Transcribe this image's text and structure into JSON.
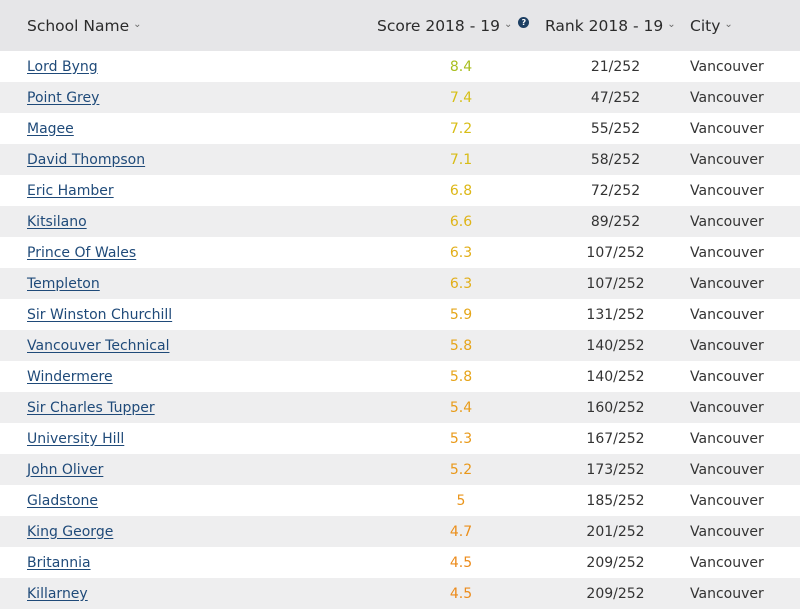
{
  "header": {
    "school_name": "School Name",
    "score": "Score 2018 - 19",
    "rank": "Rank 2018 - 19",
    "city": "City",
    "caret_icon": "chevron-down-icon",
    "help_icon": "?"
  },
  "colors": {
    "header_bg": "#e6e6e8",
    "link": "#1f4a79",
    "stripe": "#eeeeef"
  },
  "rows": [
    {
      "name": "Lord Byng",
      "score": "8.4",
      "rank": "21/252",
      "city": "Vancouver",
      "score_color": "#a8be1e"
    },
    {
      "name": "Point Grey",
      "score": "7.4",
      "rank": "47/252",
      "city": "Vancouver",
      "score_color": "#d6bf16"
    },
    {
      "name": "Magee",
      "score": "7.2",
      "rank": "55/252",
      "city": "Vancouver",
      "score_color": "#d8bd16"
    },
    {
      "name": "David Thompson",
      "score": "7.1",
      "rank": "58/252",
      "city": "Vancouver",
      "score_color": "#d8bc16"
    },
    {
      "name": "Eric Hamber",
      "score": "6.8",
      "rank": "72/252",
      "city": "Vancouver",
      "score_color": "#ddb716"
    },
    {
      "name": "Kitsilano",
      "score": "6.6",
      "rank": "89/252",
      "city": "Vancouver",
      "score_color": "#dfb417"
    },
    {
      "name": "Prince Of Wales",
      "score": "6.3",
      "rank": "107/252",
      "city": "Vancouver",
      "score_color": "#e2ae18"
    },
    {
      "name": "Templeton",
      "score": "6.3",
      "rank": "107/252",
      "city": "Vancouver",
      "score_color": "#e2ae18"
    },
    {
      "name": "Sir Winston Churchill",
      "score": "5.9",
      "rank": "131/252",
      "city": "Vancouver",
      "score_color": "#e5a619"
    },
    {
      "name": "Vancouver Technical",
      "score": "5.8",
      "rank": "140/252",
      "city": "Vancouver",
      "score_color": "#e6a419"
    },
    {
      "name": "Windermere",
      "score": "5.8",
      "rank": "140/252",
      "city": "Vancouver",
      "score_color": "#e6a419"
    },
    {
      "name": "Sir Charles Tupper",
      "score": "5.4",
      "rank": "160/252",
      "city": "Vancouver",
      "score_color": "#e89c1a"
    },
    {
      "name": "University Hill",
      "score": "5.3",
      "rank": "167/252",
      "city": "Vancouver",
      "score_color": "#e99a1a"
    },
    {
      "name": "John Oliver",
      "score": "5.2",
      "rank": "173/252",
      "city": "Vancouver",
      "score_color": "#e9981a"
    },
    {
      "name": "Gladstone",
      "score": "5",
      "rank": "185/252",
      "city": "Vancouver",
      "score_color": "#ea951b"
    },
    {
      "name": "King George",
      "score": "4.7",
      "rank": "201/252",
      "city": "Vancouver",
      "score_color": "#eb8f1b"
    },
    {
      "name": "Britannia",
      "score": "4.5",
      "rank": "209/252",
      "city": "Vancouver",
      "score_color": "#ec8b1b"
    },
    {
      "name": "Killarney",
      "score": "4.5",
      "rank": "209/252",
      "city": "Vancouver",
      "score_color": "#ec8b1b"
    }
  ]
}
